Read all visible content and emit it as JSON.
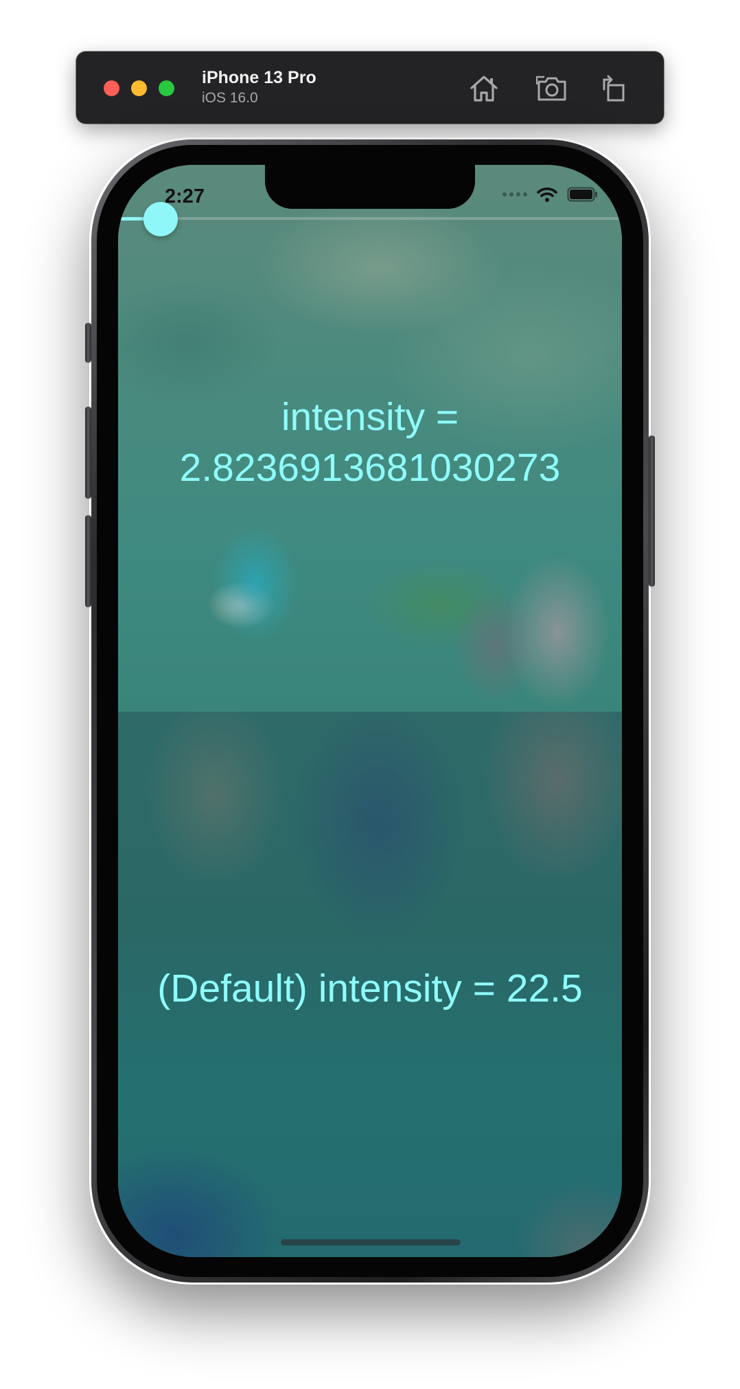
{
  "simulator": {
    "device_name": "iPhone 13 Pro",
    "os_version": "iOS 16.0",
    "buttons": {
      "home_icon": "house-icon",
      "screenshot_icon": "camera-icon",
      "rotate_icon": "rotate-icon"
    }
  },
  "status_bar": {
    "time": "2:27",
    "icons": [
      "signal-icon",
      "wifi-icon",
      "battery-icon"
    ]
  },
  "slider": {
    "value_fraction": 0.085,
    "fill_color": "#8ff5f5",
    "thumb_color": "#8ff7f7"
  },
  "intensity": {
    "line1": "intensity =",
    "line2": "2.8236913681030273"
  },
  "default_intensity": {
    "text": "(Default) intensity = 22.5"
  },
  "colors": {
    "label_text": "#8ffcfc",
    "toolbar_bg": "#232326"
  }
}
